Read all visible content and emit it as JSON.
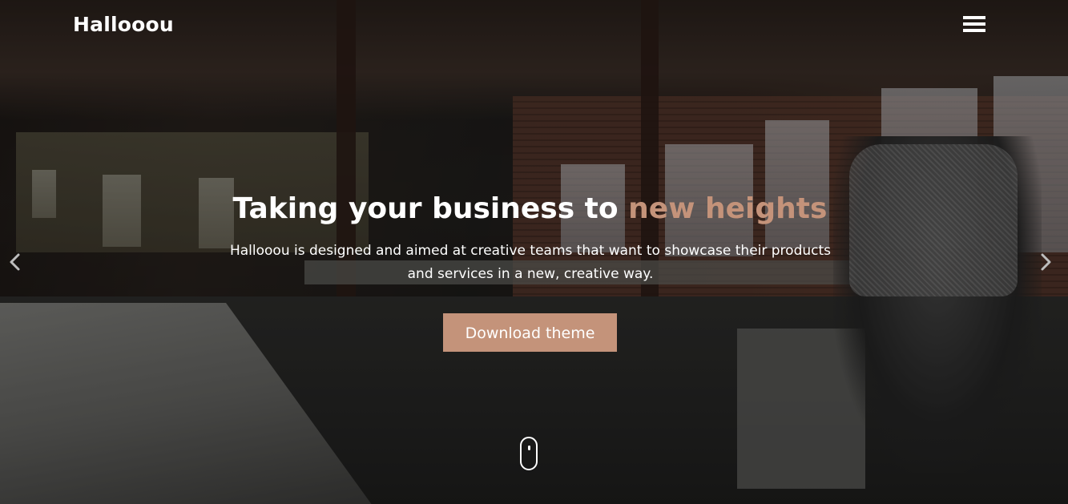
{
  "brand": {
    "name": "Hallooou"
  },
  "nav": {
    "menu_icon": "hamburger-menu-icon"
  },
  "hero": {
    "headline_main": "Taking your business to",
    "headline_accent": "new heights",
    "subtitle": "Hallooou is designed and aimed at creative teams that want to showcase their products and services in a new, creative way.",
    "cta_label": "Download theme",
    "prev_icon": "chevron-left-icon",
    "next_icon": "chevron-right-icon",
    "scroll_icon": "mouse-scroll-icon"
  },
  "colors": {
    "accent": "#c4937a",
    "text": "#ffffff"
  }
}
